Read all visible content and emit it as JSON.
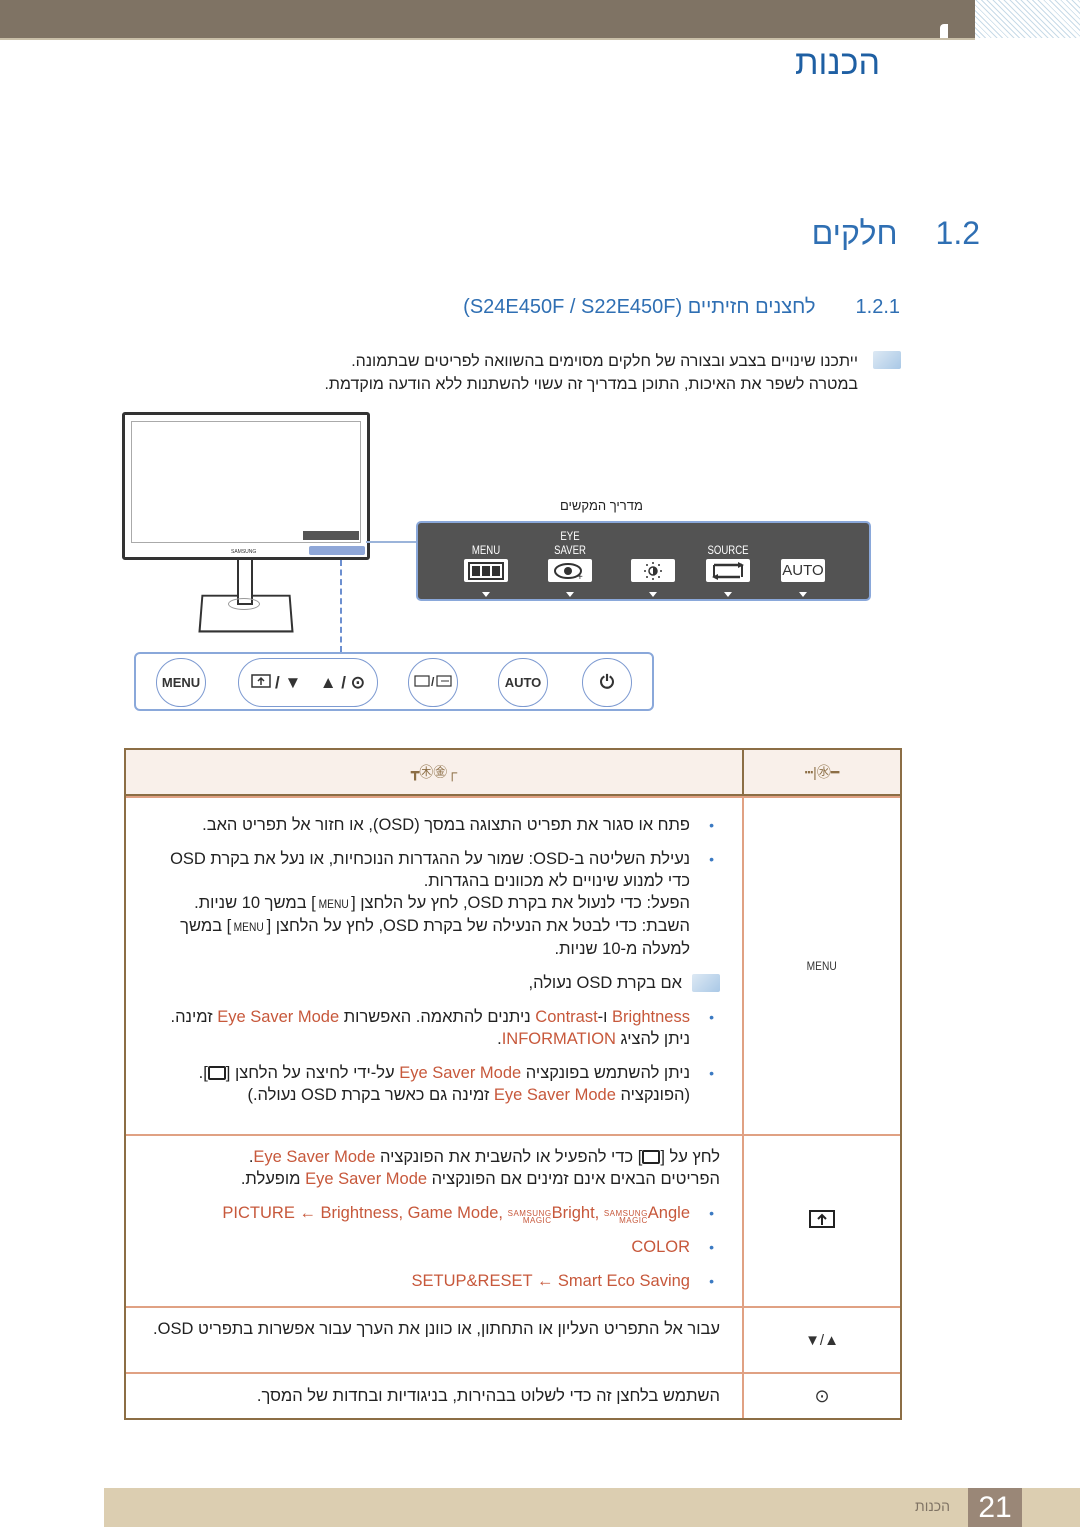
{
  "header": {
    "chapter_title": "הכנות"
  },
  "section": {
    "number": "1.2",
    "title": "חלקים"
  },
  "subsection": {
    "number": "1.2.1",
    "title": "לחצנים חזיתיים (S24E450F / S22E450F)"
  },
  "note": {
    "line1": "ייתכנו שינויים בצבע ובצורה של חלקים מסוימים בהשוואה לפריטים שבתמונה.",
    "line2": "במטרה לשפר את האיכות, התוכן במדריך זה עשוי להשתנות ללא הודעה מוקדמת."
  },
  "illustration": {
    "monitor_logo": "SAMSUNG",
    "guide_label": "מדריך המקשים",
    "guide_keys": [
      {
        "label": "MENU",
        "icon": "menu-grid-icon"
      },
      {
        "label": "EYE SAVER",
        "icon": "eye-saver-icon"
      },
      {
        "label": "",
        "icon": "brightness-icon"
      },
      {
        "label": "SOURCE",
        "icon": "source-icon"
      },
      {
        "label": "",
        "icon": "auto-icon",
        "box_text": "AUTO"
      }
    ],
    "buttons": [
      {
        "label": "MENU"
      },
      {
        "label": "/ ▼",
        "icon": "eye-saver-button-icon"
      },
      {
        "label": "▲ / ⊙"
      },
      {
        "label": "/",
        "icon": "source-button-icon"
      },
      {
        "label": "AUTO"
      },
      {
        "label": "⏻",
        "icon": "power-icon"
      }
    ]
  },
  "table": {
    "headers": {
      "col1": "━㊌|┅",
      "col2": "┌㊍㊎┳"
    },
    "rows": [
      {
        "key": "MENU",
        "bullets": [
          "פתח או סגור את תפריט התצוגה במסך (OSD), או חזור אל תפריט האב.",
          "נעילת השליטה ב-OSD: שמור על ההגדרות הנוכחיות, או נעל את בקרת OSD כדי למנוע שינויים לא מכוונים בהגדרות."
        ],
        "enable_text": "הפעל: כדי לנעול את בקרת OSD, לחץ על הלחצן [",
        "enable_menu": "MENU",
        "enable_tail": "] במשך 10 שניות.",
        "disable_text": "השבת: כדי לבטל את הנעילה של בקרת OSD, לחץ על הלחצן [",
        "disable_menu": "MENU",
        "disable_tail": "] במשך למעלה מ-10 שניות.",
        "locked_note": "אם בקרת OSD נעולה,",
        "locked_b1_a": "Brightness",
        "locked_b1_b": " ו-",
        "locked_b1_c": "Contrast",
        "locked_b1_d": " ניתנים להתאמה. האפשרות ",
        "locked_b1_e": "Eye Saver Mode",
        "locked_b1_f": " זמינה. ניתן להציג ",
        "locked_b1_g": "INFORMATION",
        "locked_b1_h": ".",
        "locked_b2_a": "ניתן להשתמש בפונקציה ",
        "locked_b2_b": "Eye Saver Mode",
        "locked_b2_c": " על-ידי לחיצה על הלחצן [",
        "locked_b2_d": "]. (הפונקציה ",
        "locked_b2_e": "Eye Saver Mode",
        "locked_b2_f": " זמינה גם כאשר בקרת OSD נעולה.)"
      },
      {
        "key_icon": "eye-saver-key-icon",
        "p1_a": "לחץ על [",
        "p1_b": "] כדי להפעיל או להשבית את הפונקציה ",
        "p1_c": "Eye Saver Mode",
        "p1_d": ".",
        "p2_a": "הפריטים הבאים אינם זמינים אם הפונקציה ",
        "p2_b": "Eye Saver Mode",
        "p2_c": " מופעלת.",
        "b1": "PICTURE ← Brightness, Game Mode, ",
        "b1_magic1": "Bright",
        "b1_magic2": "Angle",
        "magic_top": "SAMSUNG",
        "magic_bottom": "MAGIC",
        "b2": "COLOR",
        "b3": "SETUP&RESET ← Smart Eco Saving"
      },
      {
        "key": "▲/▼",
        "text": "עבור אל התפריט העליון או התחתון, או כוונן את הערך עבור אפשרות בתפריט OSD."
      },
      {
        "key": "⊙",
        "text": "השתמש בלחצן זה כדי לשלוט בבהירות, בניגודיות ובחדות של המסך."
      }
    ]
  },
  "footer": {
    "page_number": "21",
    "chapter": "הכנות"
  }
}
